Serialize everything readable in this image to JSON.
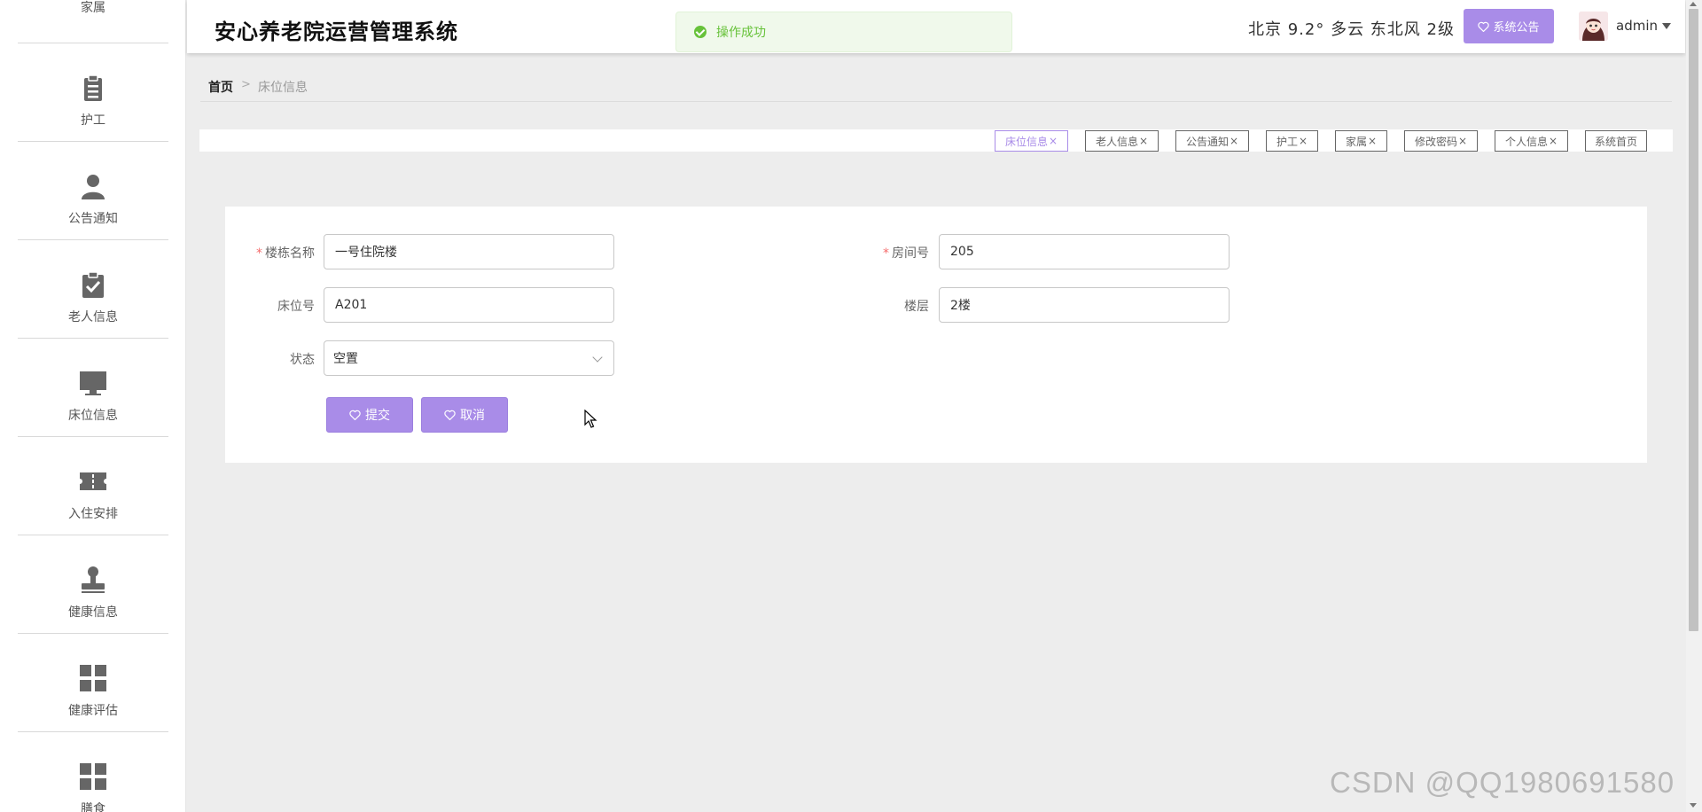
{
  "app": {
    "title": "安心养老院运营管理系统",
    "weather": "北京 9.2° 多云 东北风 2级",
    "notice_button": "系统公告",
    "user": "admin"
  },
  "toast": {
    "message": "操作成功"
  },
  "sidebar": {
    "top_partial": "家属",
    "items": [
      {
        "label": "护工",
        "icon": "clipboard-icon"
      },
      {
        "label": "公告通知",
        "icon": "person-icon"
      },
      {
        "label": "老人信息",
        "icon": "checklist-icon"
      },
      {
        "label": "床位信息",
        "icon": "monitor-icon"
      },
      {
        "label": "入住安排",
        "icon": "ticket-icon"
      },
      {
        "label": "健康信息",
        "icon": "stamp-icon"
      },
      {
        "label": "健康评估",
        "icon": "grid-icon"
      },
      {
        "label": "膳食",
        "icon": "grid-icon"
      }
    ]
  },
  "breadcrumb": {
    "home": "首页",
    "separator": ">",
    "current": "床位信息"
  },
  "tags": [
    {
      "label": "床位信息",
      "closable": true,
      "active": true
    },
    {
      "label": "老人信息",
      "closable": true
    },
    {
      "label": "公告通知",
      "closable": true
    },
    {
      "label": "护工",
      "closable": true
    },
    {
      "label": "家属",
      "closable": true
    },
    {
      "label": "修改密码",
      "closable": true
    },
    {
      "label": "个人信息",
      "closable": true
    },
    {
      "label": "系统首页",
      "closable": false
    }
  ],
  "form": {
    "building": {
      "label": "楼栋名称",
      "value": "一号住院楼",
      "required": true
    },
    "room": {
      "label": "房间号",
      "value": "205",
      "required": true
    },
    "bed": {
      "label": "床位号",
      "value": "A201"
    },
    "floor": {
      "label": "楼层",
      "value": "2楼"
    },
    "status": {
      "label": "状态",
      "value": "空置"
    },
    "submit": "提交",
    "cancel": "取消"
  },
  "watermark": "CSDN @QQ1980691580",
  "colors": {
    "accent": "#a98ce8",
    "success": "#67c23a",
    "required": "#f56c6c"
  }
}
